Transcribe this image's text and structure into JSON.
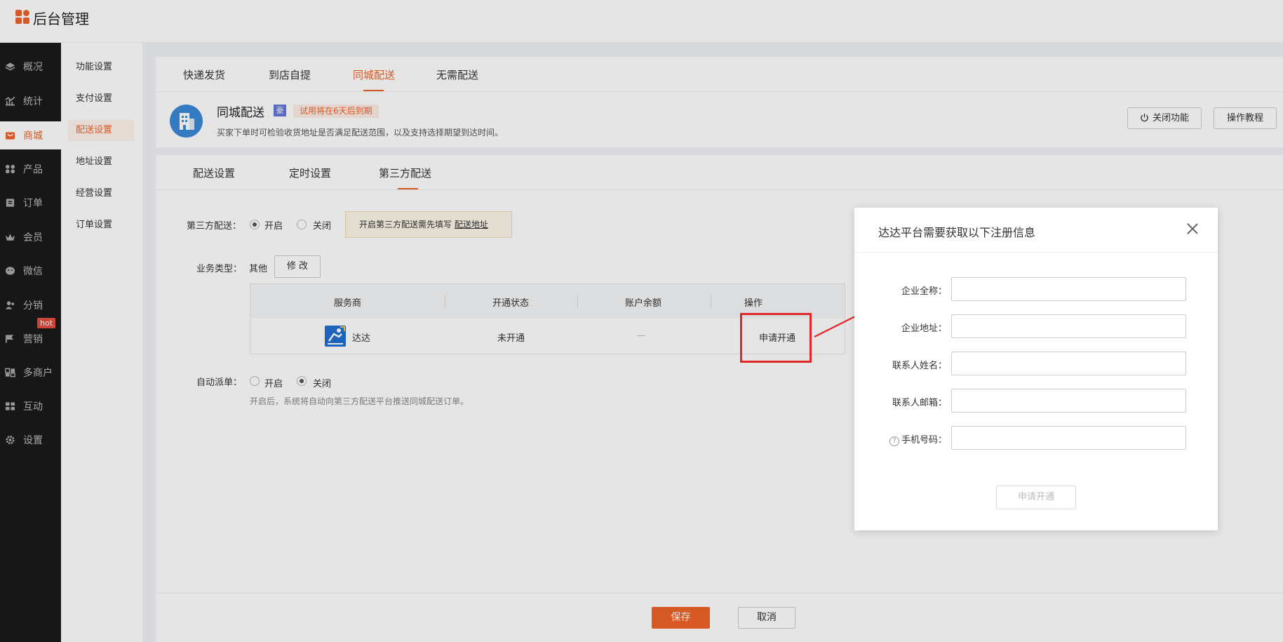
{
  "app": {
    "title": "后台管理"
  },
  "sidebar": {
    "items": [
      {
        "label": "概况",
        "icon": "layers-icon"
      },
      {
        "label": "统计",
        "icon": "chart-icon"
      },
      {
        "label": "商城",
        "icon": "mall-icon"
      },
      {
        "label": "产品",
        "icon": "grid-icon"
      },
      {
        "label": "订单",
        "icon": "order-icon"
      },
      {
        "label": "会员",
        "icon": "crown-icon"
      },
      {
        "label": "微信",
        "icon": "wechat-icon"
      },
      {
        "label": "分销",
        "icon": "users-icon"
      },
      {
        "label": "营销",
        "icon": "flag-icon"
      },
      {
        "label": "多商户",
        "icon": "store-icon"
      },
      {
        "label": "互动",
        "icon": "apps-icon"
      },
      {
        "label": "设置",
        "icon": "gear-icon"
      }
    ],
    "hot_badge": "hot",
    "active": "商城"
  },
  "subnav": {
    "items": [
      "功能设置",
      "支付设置",
      "配送设置",
      "地址设置",
      "经营设置",
      "订单设置"
    ],
    "active": "配送设置"
  },
  "delivery_tabs": [
    "快递发货",
    "到店自提",
    "同城配送",
    "无需配送"
  ],
  "service": {
    "name": "同城配送",
    "pro_badge": "豪",
    "trial": "试用将在6天后到期",
    "description": "买家下单时可检验收货地址是否满足配送范围，以及支持选择期望到达时间。",
    "close_btn": "关闭功能",
    "tutorial_btn": "操作教程"
  },
  "settings_tabs": [
    "配送设置",
    "定时设置",
    "第三方配送"
  ],
  "form": {
    "third_party_label": "第三方配送：",
    "on": "开启",
    "off": "关闭",
    "notice_text": "开启第三方配送需先填写 ",
    "notice_link": "配送地址",
    "biz_type_label": "业务类型：",
    "biz_type_value": "其他",
    "modify_btn": "修 改",
    "auto_dispatch_label": "自动派单：",
    "auto_help": "开启后，系统将自动向第三方配送平台推送同城配送订单。"
  },
  "table": {
    "headers": [
      "服务商",
      "开通状态",
      "账户余额",
      "操作"
    ],
    "rows": [
      {
        "provider": "达达",
        "status": "未开通",
        "balance": "—",
        "action": "申请开通"
      }
    ]
  },
  "footer": {
    "save": "保存",
    "cancel": "取消"
  },
  "modal": {
    "title": "达达平台需要获取以下注册信息",
    "fields": [
      {
        "label": "企业全称：",
        "value": ""
      },
      {
        "label": "企业地址：",
        "value": ""
      },
      {
        "label": "联系人姓名：",
        "value": ""
      },
      {
        "label": "联系人邮箱：",
        "value": ""
      },
      {
        "label": "手机号码：",
        "value": ""
      }
    ],
    "submit": "申请开通"
  },
  "colors": {
    "accent": "#f0642a",
    "highlight": "#e0282a",
    "sidebar": "#1a1a1a"
  }
}
